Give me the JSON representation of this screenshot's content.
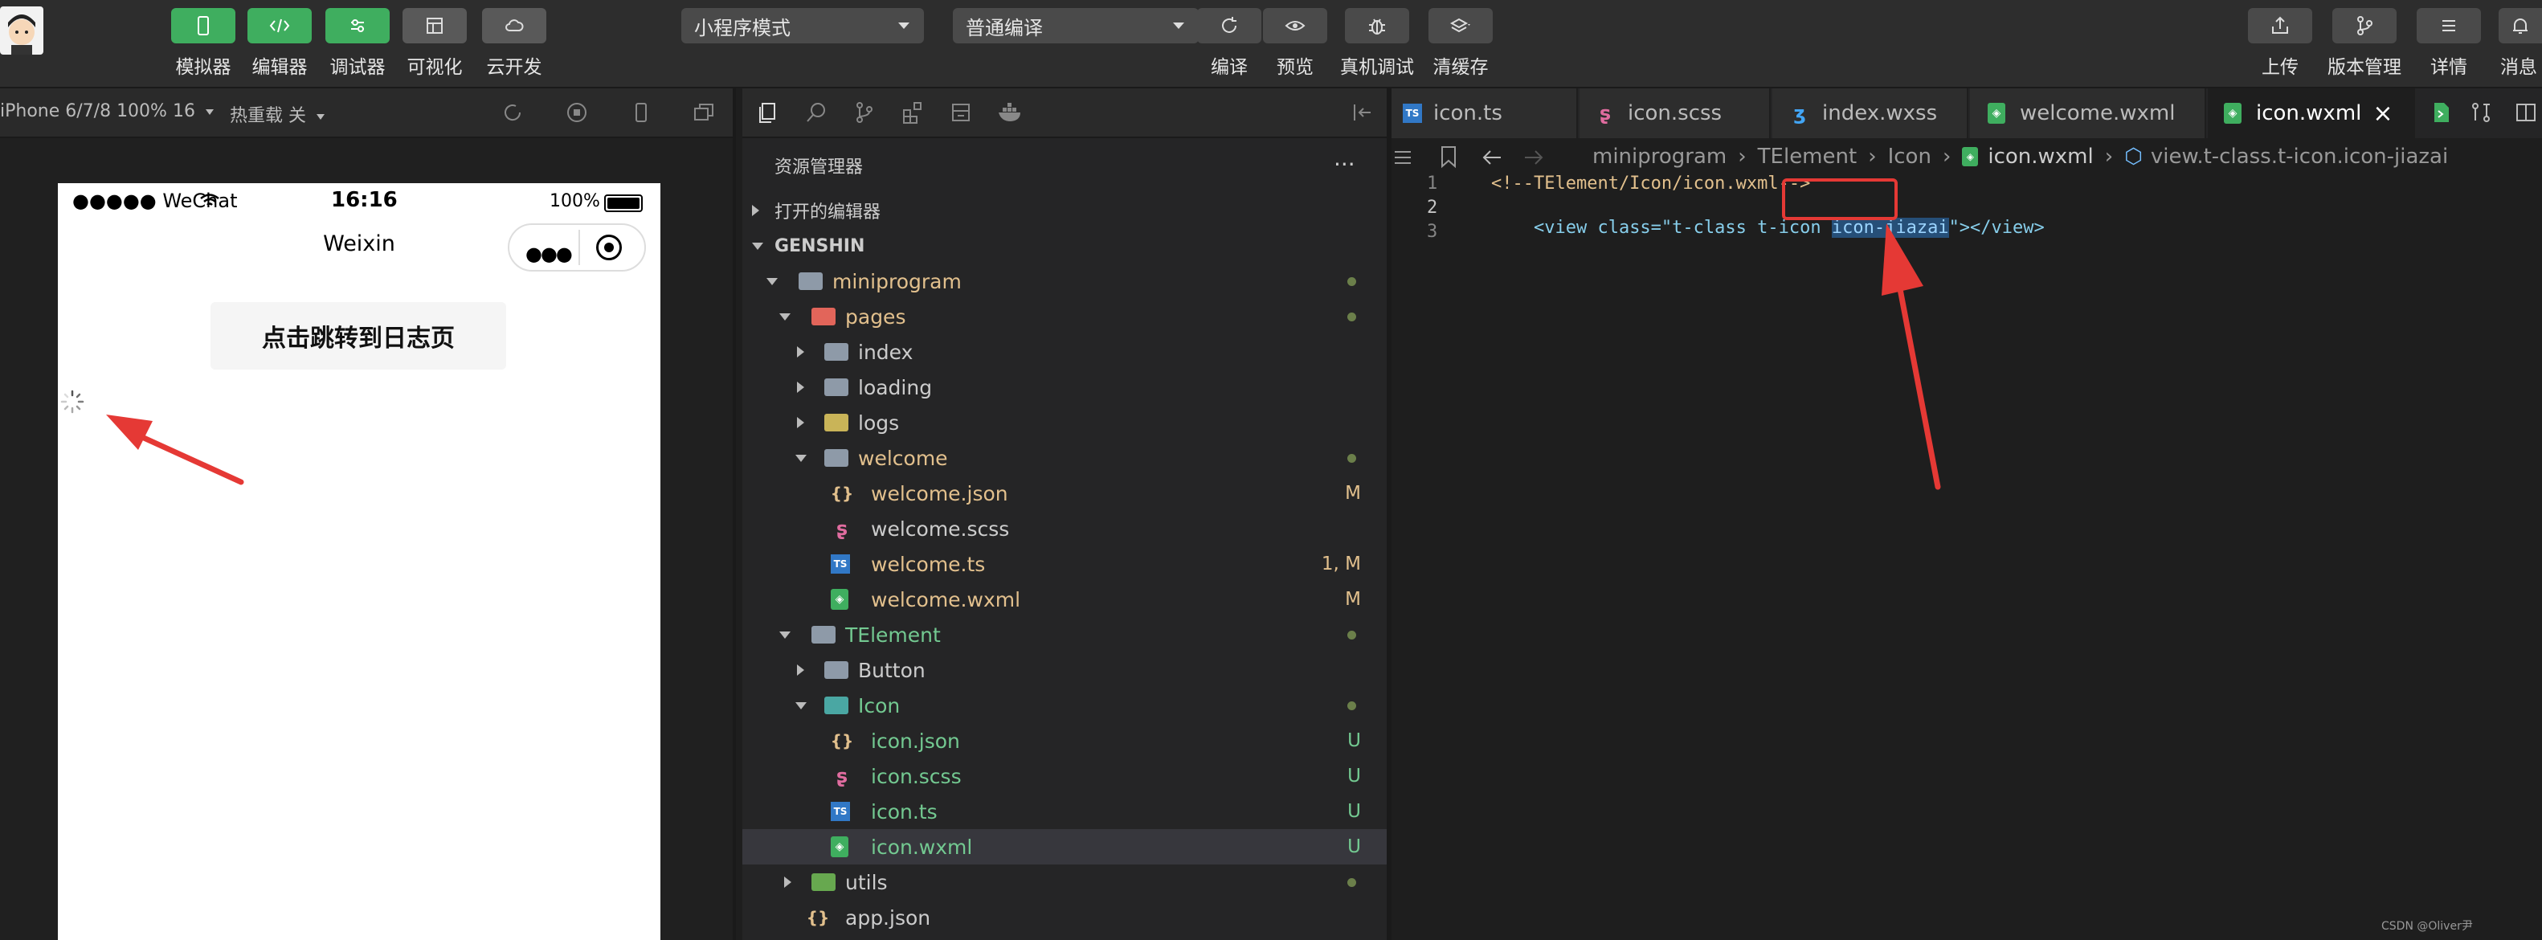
{
  "toolbar": {
    "left_buttons": [
      {
        "label": "模拟器",
        "icon": "phone-icon"
      },
      {
        "label": "编辑器",
        "icon": "code-icon"
      },
      {
        "label": "调试器",
        "icon": "sliders-icon"
      },
      {
        "label": "可视化",
        "icon": "layout-icon"
      },
      {
        "label": "云开发",
        "icon": "cloud-icon"
      }
    ],
    "mode_select": "小程序模式",
    "compile_select": "普通编译",
    "mid_buttons": [
      {
        "label": "编译",
        "icon": "refresh-icon"
      },
      {
        "label": "预览",
        "icon": "eye-icon"
      },
      {
        "label": "真机调试",
        "icon": "bug-icon"
      },
      {
        "label": "清缓存",
        "icon": "layers-icon"
      }
    ],
    "right_buttons": [
      {
        "label": "上传",
        "icon": "upload-icon"
      },
      {
        "label": "版本管理",
        "icon": "branch-icon"
      },
      {
        "label": "详情",
        "icon": "menu-icon"
      },
      {
        "label": "消息",
        "icon": "bell-icon"
      }
    ]
  },
  "simulator": {
    "device": "iPhone 6/7/8 100% 16",
    "hot_reload": "热重载 关",
    "status_carrier": "●●●●● WeChat",
    "status_time": "16:16",
    "status_battery": "100%",
    "nav_title": "Weixin",
    "page_button": "点击跳转到日志页"
  },
  "explorer": {
    "title": "资源管理器",
    "more": "...",
    "open_editors": "打开的编辑器",
    "project": "GENSHIN",
    "tree": [
      {
        "label": "miniprogram",
        "status": "dot"
      },
      {
        "label": "pages",
        "status": "dot"
      },
      {
        "label": "index",
        "status": ""
      },
      {
        "label": "loading",
        "status": ""
      },
      {
        "label": "logs",
        "status": ""
      },
      {
        "label": "welcome",
        "status": "dot"
      },
      {
        "label": "welcome.json",
        "status": "M"
      },
      {
        "label": "welcome.scss",
        "status": ""
      },
      {
        "label": "welcome.ts",
        "status": "1, M"
      },
      {
        "label": "welcome.wxml",
        "status": "M"
      },
      {
        "label": "TElement",
        "status": "dot"
      },
      {
        "label": "Button",
        "status": ""
      },
      {
        "label": "Icon",
        "status": "dot"
      },
      {
        "label": "icon.json",
        "status": "U"
      },
      {
        "label": "icon.scss",
        "status": "U"
      },
      {
        "label": "icon.ts",
        "status": "U"
      },
      {
        "label": "icon.wxml",
        "status": "U"
      },
      {
        "label": "utils",
        "status": "dot"
      },
      {
        "label": "app.json",
        "status": ""
      }
    ]
  },
  "editor": {
    "tabs": [
      "icon.ts",
      "icon.scss",
      "index.wxss",
      "welcome.wxml",
      "icon.wxml"
    ],
    "active_tab_close": "×",
    "breadcrumb": [
      "miniprogram",
      "TElement",
      "Icon",
      "icon.wxml",
      "view.t-class.t-icon.icon-jiazai"
    ],
    "line_numbers": [
      "1",
      "2",
      "3"
    ],
    "line1": "<!--TElement/Icon/icon.wxml-->",
    "line2_prefix": "<view class=\"t-class t-icon ",
    "line2_highlight": "icon-jiazai",
    "line2_suffix": "\"></view>",
    "watermark": "CSDN @Oliver尹"
  },
  "colors": {
    "accent_green": "#3fae5f",
    "annotation_red": "#e53935",
    "modified_yellow": "#e2c08d",
    "untracked_green": "#73c991"
  }
}
